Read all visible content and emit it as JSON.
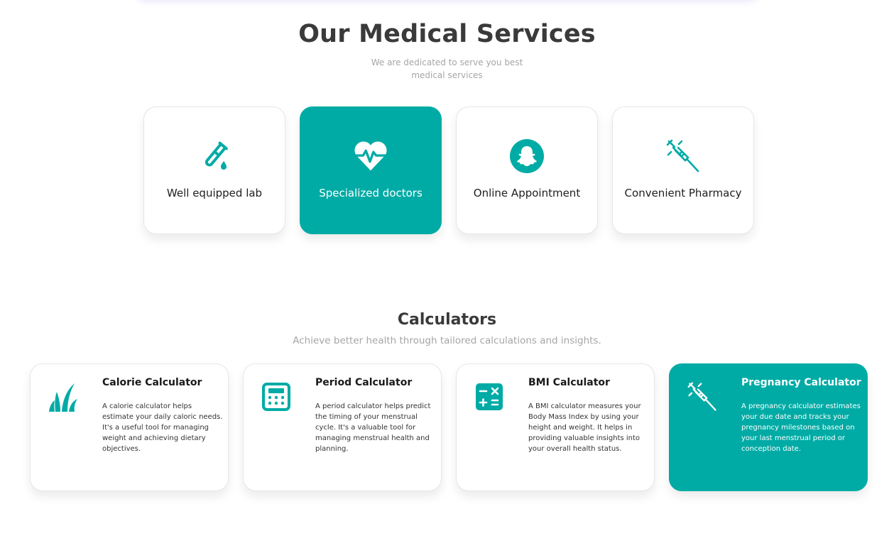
{
  "colors": {
    "accent": "#00aba5",
    "title": "#3a3a3a",
    "muted": "#a6a6a6"
  },
  "services": {
    "title": "Our Medical Services",
    "subtitle_line1": "We are dedicated to serve you best",
    "subtitle_line2": "medical services",
    "cards": [
      {
        "label": "Well equipped lab",
        "icon": "test-tube-icon",
        "active": false
      },
      {
        "label": "Specialized doctors",
        "icon": "heart-pulse-icon",
        "active": true
      },
      {
        "label": "Online Appointment",
        "icon": "snapchat-ghost-icon",
        "active": false
      },
      {
        "label": "Convenient Pharmacy",
        "icon": "syringe-icon",
        "active": false
      }
    ]
  },
  "calculators": {
    "title": "Calculators",
    "subtitle": "Achieve better health through tailored calculations and insights.",
    "cards": [
      {
        "title": "Calorie Calculator",
        "icon": "grass-icon",
        "active": false,
        "description": "A calorie calculator helps estimate your daily caloric needs. It's a useful tool for managing weight and achieving dietary objectives."
      },
      {
        "title": "Period Calculator",
        "icon": "calculator-icon",
        "active": false,
        "description": "A period calculator helps predict the timing of your menstrual cycle. It's a valuable tool for managing menstrual health and planning."
      },
      {
        "title": "BMI Calculator",
        "icon": "math-operations-icon",
        "active": false,
        "description": "A BMI calculator measures your Body Mass Index by using your height and weight. It helps in providing valuable insights into your overall health status."
      },
      {
        "title": "Pregnancy Calculator",
        "icon": "syringe-icon",
        "active": true,
        "description": "A pregnancy calculator estimates your due date and tracks your pregnancy milestones based on your last menstrual period or conception date."
      }
    ]
  }
}
